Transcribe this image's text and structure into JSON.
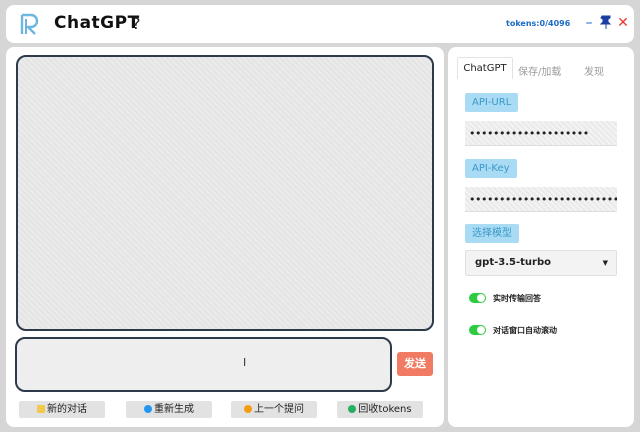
{
  "header": {
    "title": "ChatGPT",
    "help_label": "?",
    "tokens": "tokens:0/4096"
  },
  "icons": {
    "logo": "logo-icon",
    "minimize": "minimize-icon",
    "pin": "pin-icon",
    "close": "close-icon"
  },
  "input": {
    "cursor": "I"
  },
  "send_label": "发送",
  "toolbar": [
    {
      "label": "新的对话",
      "icon": "new-chat-icon"
    },
    {
      "label": "重新生成",
      "icon": "refresh-icon"
    },
    {
      "label": "上一个提问",
      "icon": "previous-icon"
    },
    {
      "label": "回收tokens",
      "icon": "recycle-icon"
    }
  ],
  "side": {
    "tabs": [
      "ChatGPT",
      "保存/加载",
      "发现"
    ],
    "api_url": {
      "label": "API-URL",
      "value": "••••••••••••••••••••"
    },
    "api_key": {
      "label": "API-Key",
      "value": "••••••••••••••••••••••••••••"
    },
    "model": {
      "label": "选择模型",
      "value": "gpt-3.5-turbo"
    },
    "toggles": [
      {
        "label": "实时传输回答",
        "on": true
      },
      {
        "label": "对话窗口自动滚动",
        "on": true
      }
    ]
  },
  "colors": {
    "accent": "#1a6bc4",
    "send": "#f07a62",
    "chip": "#a9dcf4",
    "toggle_on": "#2ecc40",
    "close": "#e53935"
  }
}
